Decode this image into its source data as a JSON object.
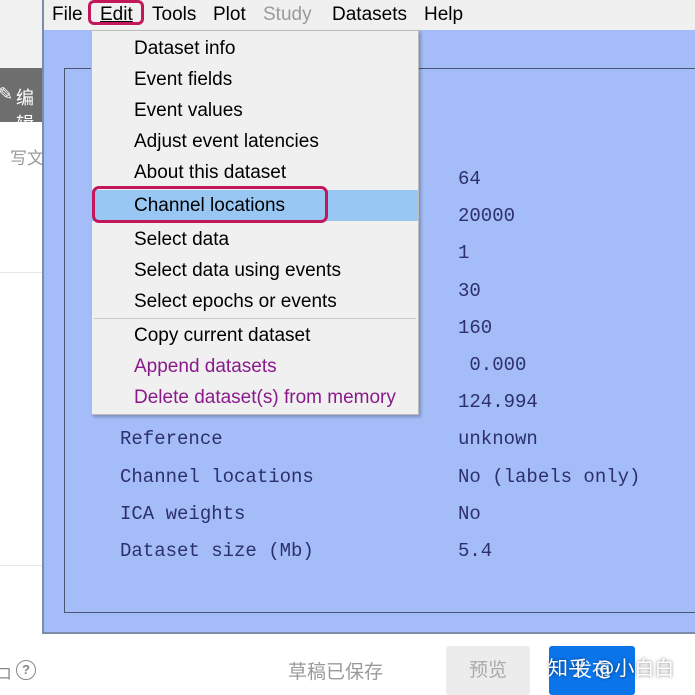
{
  "background": {
    "toolbar_edit_label": "编辑",
    "editor_placeholder": "写文",
    "footer": {
      "saved_status": "草稿已保存",
      "preview_label": "预览",
      "publish_label": "发布",
      "watermark": "知乎 @小白白"
    }
  },
  "menubar": {
    "items": [
      "File",
      "Edit",
      "Tools",
      "Plot",
      "Study",
      "Datasets",
      "Help"
    ],
    "active": "Edit",
    "disabled": [
      "Study"
    ]
  },
  "edit_menu": {
    "items": [
      {
        "label": "Dataset info"
      },
      {
        "label": "Event fields"
      },
      {
        "label": "Event values"
      },
      {
        "label": "Adjust event latencies"
      },
      {
        "label": "About this dataset"
      },
      {
        "label": "Channel locations",
        "selected": true
      },
      {
        "label": "Select data"
      },
      {
        "label": "Select data using events"
      },
      {
        "label": "Select epochs or events"
      },
      {
        "label": "Copy current dataset"
      },
      {
        "label": "Append datasets",
        "color": "purple"
      },
      {
        "label": "Delete dataset(s) from memory",
        "color": "purple"
      }
    ]
  },
  "dataset_info": {
    "values_visible": [
      "64",
      "20000",
      "1",
      "30",
      "160",
      " 0.000",
      "124.994"
    ],
    "rows": [
      {
        "label": "Reference",
        "value": "unknown"
      },
      {
        "label": "Channel locations",
        "value": "No (labels only)"
      },
      {
        "label": "ICA weights",
        "value": "No"
      },
      {
        "label": "Dataset size (Mb)",
        "value": "5.4"
      }
    ]
  },
  "colors": {
    "window_bg": "#a4bdf8",
    "menu_bg": "#f0f0f0",
    "selection": "#99c7f3",
    "annotation_highlight": "#c2185b",
    "info_text": "#2d2f6e",
    "purple_item": "#8a1a8c",
    "publish_button": "#0a74ea"
  }
}
